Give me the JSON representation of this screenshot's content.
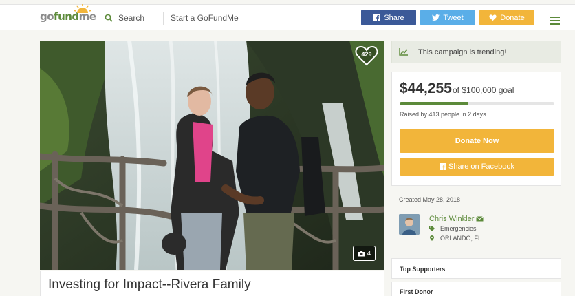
{
  "header": {
    "logo": {
      "go": "go",
      "fund": "fund",
      "me": "me"
    },
    "search_label": "Search",
    "start_label": "Start a GoFundMe",
    "share_label": "Share",
    "tweet_label": "Tweet",
    "donate_label": "Donate"
  },
  "campaign": {
    "heart_count": "429",
    "photo_count": "4",
    "title": "Investing for Impact--Rivera Family"
  },
  "sidebar": {
    "trending_text": "This campaign is trending!",
    "raised": "$44,255",
    "goal_text": "of $100,000 goal",
    "progress_fraction": 0.44,
    "raised_by": "Raised by 413 people in 2 days",
    "donate_now": "Donate Now",
    "share_facebook": "Share on Facebook",
    "created": "Created May 28, 2018",
    "organizer": {
      "name": "Chris Winkler",
      "category": "Emergencies",
      "location": "ORLANDO, FL"
    },
    "top_supporters": "Top Supporters",
    "first_donor": "First Donor"
  },
  "colors": {
    "brand_green": "#5c8a3a",
    "facebook_blue": "#3b5998",
    "twitter_blue": "#5aaee8",
    "donate_orange": "#f2b53a"
  },
  "icons": [
    "search-icon",
    "facebook-icon",
    "twitter-icon",
    "heart-icon",
    "menu-icon",
    "heart-outline-icon",
    "camera-icon",
    "trend-chart-icon",
    "envelope-icon",
    "tag-icon",
    "map-pin-icon"
  ]
}
